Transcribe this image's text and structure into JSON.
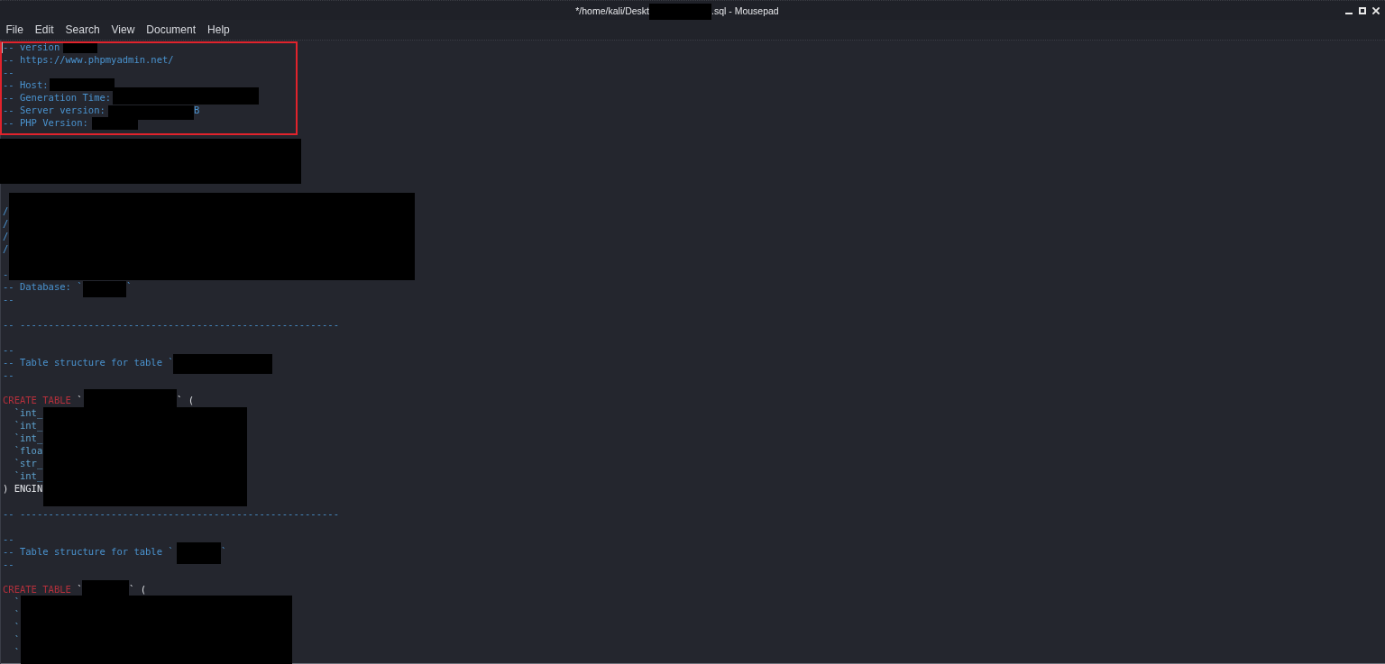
{
  "window": {
    "title": [
      {
        "kind": "text",
        "text": "*/home/kali/Deskt"
      },
      {
        "kind": "redacted"
      },
      {
        "kind": "text",
        "text": ".sql - Mousepad"
      }
    ]
  },
  "menu": [
    "File",
    "Edit",
    "Search",
    "View",
    "Document",
    "Help"
  ],
  "editor": {
    "highlight_frame": true,
    "cursor": true,
    "lines": [
      {
        "kind": "code",
        "segments": [
          {
            "kind": "comment",
            "text": "-- version"
          },
          {
            "kind": "redacted"
          }
        ]
      },
      {
        "kind": "code",
        "segments": [
          {
            "kind": "comment",
            "text": "-- https://www.phpmyadmin.net/"
          }
        ]
      },
      {
        "kind": "code",
        "segments": [
          {
            "kind": "comment",
            "text": "--"
          }
        ]
      },
      {
        "kind": "code",
        "segments": [
          {
            "kind": "comment",
            "text": "-- Host:"
          },
          {
            "kind": "redacted"
          }
        ]
      },
      {
        "kind": "code",
        "segments": [
          {
            "kind": "comment",
            "text": "-- Generation Time:"
          },
          {
            "kind": "redacted"
          }
        ]
      },
      {
        "kind": "code",
        "segments": [
          {
            "kind": "comment",
            "text": "-- Server version:"
          },
          {
            "kind": "redacted"
          },
          {
            "kind": "comment",
            "text": "B"
          }
        ]
      },
      {
        "kind": "code",
        "segments": [
          {
            "kind": "comment",
            "text": "-- PHP Version:"
          },
          {
            "kind": "redacted"
          }
        ]
      },
      {
        "kind": "code",
        "segments": [
          {
            "kind": "redacted"
          }
        ]
      },
      {
        "kind": "blank"
      },
      {
        "kind": "blank"
      },
      {
        "kind": "blank"
      },
      {
        "kind": "blank"
      },
      {
        "kind": "code",
        "segments": [
          {
            "kind": "redacted"
          }
        ]
      },
      {
        "kind": "code",
        "segments": [
          {
            "kind": "comment",
            "text": "/"
          }
        ]
      },
      {
        "kind": "code",
        "segments": [
          {
            "kind": "comment",
            "text": "/"
          }
        ]
      },
      {
        "kind": "code",
        "segments": [
          {
            "kind": "comment",
            "text": "/"
          }
        ]
      },
      {
        "kind": "code",
        "segments": [
          {
            "kind": "comment",
            "text": "/"
          }
        ]
      },
      {
        "kind": "blank"
      },
      {
        "kind": "code",
        "segments": [
          {
            "kind": "comment",
            "text": "-"
          }
        ]
      },
      {
        "kind": "code",
        "segments": [
          {
            "kind": "comment",
            "text": "-- Database: `"
          },
          {
            "kind": "redacted"
          },
          {
            "kind": "comment",
            "text": "`"
          }
        ]
      },
      {
        "kind": "code",
        "segments": [
          {
            "kind": "comment",
            "text": "--"
          }
        ]
      },
      {
        "kind": "blank"
      },
      {
        "kind": "code",
        "segments": [
          {
            "kind": "comment",
            "text": "-- --------------------------------------------------------"
          }
        ]
      },
      {
        "kind": "blank"
      },
      {
        "kind": "code",
        "segments": [
          {
            "kind": "comment",
            "text": "--"
          }
        ]
      },
      {
        "kind": "code",
        "segments": [
          {
            "kind": "comment",
            "text": "-- Table structure for table `"
          },
          {
            "kind": "redacted"
          }
        ]
      },
      {
        "kind": "code",
        "segments": [
          {
            "kind": "comment",
            "text": "--"
          }
        ]
      },
      {
        "kind": "blank"
      },
      {
        "kind": "code",
        "segments": [
          {
            "kind": "keyword",
            "text": "CREATE TABLE"
          },
          {
            "kind": "plain",
            "text": "`"
          },
          {
            "kind": "redacted"
          },
          {
            "kind": "plain",
            "text": "` ("
          }
        ]
      },
      {
        "kind": "indented",
        "segments": [
          {
            "kind": "identifier",
            "text": "`int_"
          },
          {
            "kind": "redacted"
          }
        ]
      },
      {
        "kind": "indented",
        "segments": [
          {
            "kind": "identifier",
            "text": "`int_"
          }
        ]
      },
      {
        "kind": "indented",
        "segments": [
          {
            "kind": "identifier",
            "text": "`int_"
          }
        ]
      },
      {
        "kind": "indented",
        "segments": [
          {
            "kind": "identifier",
            "text": "`floa"
          }
        ]
      },
      {
        "kind": "indented",
        "segments": [
          {
            "kind": "identifier",
            "text": "`str_"
          }
        ]
      },
      {
        "kind": "indented",
        "segments": [
          {
            "kind": "identifier",
            "text": "`int_"
          }
        ]
      },
      {
        "kind": "code",
        "segments": [
          {
            "kind": "plain",
            "text": ") ENGIN"
          }
        ]
      },
      {
        "kind": "blank"
      },
      {
        "kind": "code",
        "segments": [
          {
            "kind": "comment",
            "text": "-- --------------------------------------------------------"
          }
        ]
      },
      {
        "kind": "blank"
      },
      {
        "kind": "code",
        "segments": [
          {
            "kind": "comment",
            "text": "--"
          }
        ]
      },
      {
        "kind": "code",
        "segments": [
          {
            "kind": "comment",
            "text": "-- Table structure for table `"
          },
          {
            "kind": "redacted"
          },
          {
            "kind": "comment",
            "text": "`"
          }
        ]
      },
      {
        "kind": "code",
        "segments": [
          {
            "kind": "comment",
            "text": "--"
          }
        ]
      },
      {
        "kind": "blank"
      },
      {
        "kind": "code",
        "segments": [
          {
            "kind": "keyword",
            "text": "CREATE TABLE"
          },
          {
            "kind": "plain",
            "text": "`"
          },
          {
            "kind": "redacted"
          },
          {
            "kind": "plain",
            "text": "` ("
          }
        ]
      },
      {
        "kind": "indented",
        "segments": [
          {
            "kind": "identifier",
            "text": "`"
          },
          {
            "kind": "redacted"
          }
        ]
      },
      {
        "kind": "indented",
        "segments": [
          {
            "kind": "identifier",
            "text": "`"
          }
        ]
      },
      {
        "kind": "indented",
        "segments": [
          {
            "kind": "identifier",
            "text": "`"
          }
        ]
      },
      {
        "kind": "indented",
        "segments": [
          {
            "kind": "identifier",
            "text": "`"
          }
        ]
      },
      {
        "kind": "indented",
        "segments": [
          {
            "kind": "identifier",
            "text": "`"
          }
        ]
      }
    ]
  }
}
